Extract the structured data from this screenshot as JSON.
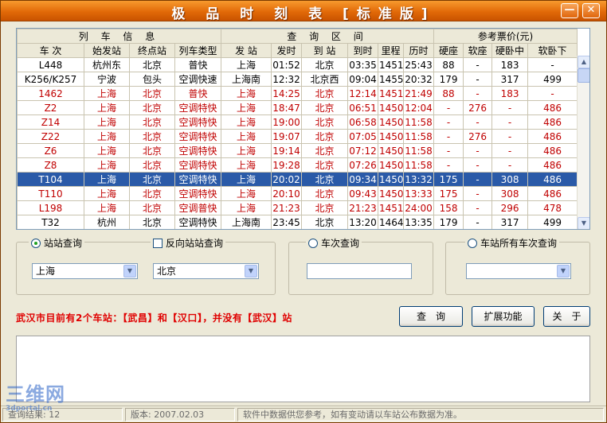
{
  "window": {
    "title": "极 品 时 刻 表 [标准版]",
    "min_glyph": "—",
    "close_glyph": "✕"
  },
  "table": {
    "groups": [
      "列 车 信 息",
      "查 询 区 间",
      "参考票价(元)"
    ],
    "columns": [
      "车 次",
      "始发站",
      "终点站",
      "列车类型",
      "发 站",
      "发时",
      "到 站",
      "到时",
      "里程",
      "历时",
      "硬座",
      "软座",
      "硬卧中",
      "软卧下"
    ],
    "rows": [
      {
        "cells": [
          "L448",
          "杭州东",
          "北京",
          "普快",
          "上海",
          "01:52",
          "北京",
          "03:35",
          "1451",
          "25:43",
          "88",
          "-",
          "183",
          "-"
        ],
        "red": false,
        "selected": false
      },
      {
        "cells": [
          "K256/K257",
          "宁波",
          "包头",
          "空调快速",
          "上海南",
          "12:32",
          "北京西",
          "09:04",
          "1455",
          "20:32",
          "179",
          "-",
          "317",
          "499"
        ],
        "red": false,
        "selected": false
      },
      {
        "cells": [
          "1462",
          "上海",
          "北京",
          "普快",
          "上海",
          "14:25",
          "北京",
          "12:14",
          "1451",
          "21:49",
          "88",
          "-",
          "183",
          "-"
        ],
        "red": true,
        "selected": false
      },
      {
        "cells": [
          "Z2",
          "上海",
          "北京",
          "空调特快",
          "上海",
          "18:47",
          "北京",
          "06:51",
          "1450",
          "12:04",
          "-",
          "276",
          "-",
          "486"
        ],
        "red": true,
        "selected": false
      },
      {
        "cells": [
          "Z14",
          "上海",
          "北京",
          "空调特快",
          "上海",
          "19:00",
          "北京",
          "06:58",
          "1450",
          "11:58",
          "-",
          "-",
          "-",
          "486"
        ],
        "red": true,
        "selected": false
      },
      {
        "cells": [
          "Z22",
          "上海",
          "北京",
          "空调特快",
          "上海",
          "19:07",
          "北京",
          "07:05",
          "1450",
          "11:58",
          "-",
          "276",
          "-",
          "486"
        ],
        "red": true,
        "selected": false
      },
      {
        "cells": [
          "Z6",
          "上海",
          "北京",
          "空调特快",
          "上海",
          "19:14",
          "北京",
          "07:12",
          "1450",
          "11:58",
          "-",
          "-",
          "-",
          "486"
        ],
        "red": true,
        "selected": false
      },
      {
        "cells": [
          "Z8",
          "上海",
          "北京",
          "空调特快",
          "上海",
          "19:28",
          "北京",
          "07:26",
          "1450",
          "11:58",
          "-",
          "-",
          "-",
          "486"
        ],
        "red": true,
        "selected": false
      },
      {
        "cells": [
          "T104",
          "上海",
          "北京",
          "空调特快",
          "上海",
          "20:02",
          "北京",
          "09:34",
          "1450",
          "13:32",
          "175",
          "-",
          "308",
          "486"
        ],
        "red": false,
        "selected": true
      },
      {
        "cells": [
          "T110",
          "上海",
          "北京",
          "空调特快",
          "上海",
          "20:10",
          "北京",
          "09:43",
          "1450",
          "13:33",
          "175",
          "-",
          "308",
          "486"
        ],
        "red": true,
        "selected": false
      },
      {
        "cells": [
          "L198",
          "上海",
          "北京",
          "空调普快",
          "上海",
          "21:23",
          "北京",
          "21:23",
          "1451",
          "24:00",
          "158",
          "-",
          "296",
          "478"
        ],
        "red": true,
        "selected": false
      },
      {
        "cells": [
          "T32",
          "杭州",
          "北京",
          "空调特快",
          "上海南",
          "23:45",
          "北京",
          "13:20",
          "1464",
          "13:35",
          "179",
          "-",
          "317",
          "499"
        ],
        "red": false,
        "selected": false
      }
    ]
  },
  "station_query": {
    "label": "站站查询",
    "selected": true,
    "from_value": "上海",
    "to_value": "北京",
    "reverse_label": "反向站站查询",
    "reverse_checked": false
  },
  "train_query": {
    "label": "车次查询",
    "selected": false,
    "value": ""
  },
  "station_all_query": {
    "label": "车站所有车次查询",
    "selected": false,
    "value": ""
  },
  "notice": "武汉市目前有2个车站：【武昌】和【汉口】，并没有【武汉】站",
  "buttons": {
    "query": "查　询",
    "extend": "扩展功能",
    "about": "关　于"
  },
  "status": {
    "left": "查询结果: 12",
    "version": "版本: 2007.02.03",
    "message": "软件中数据供您参考，如有变动请以车站公布数据为准。"
  },
  "watermark": {
    "line1": "三维网",
    "line2": "3dportal.cn"
  }
}
